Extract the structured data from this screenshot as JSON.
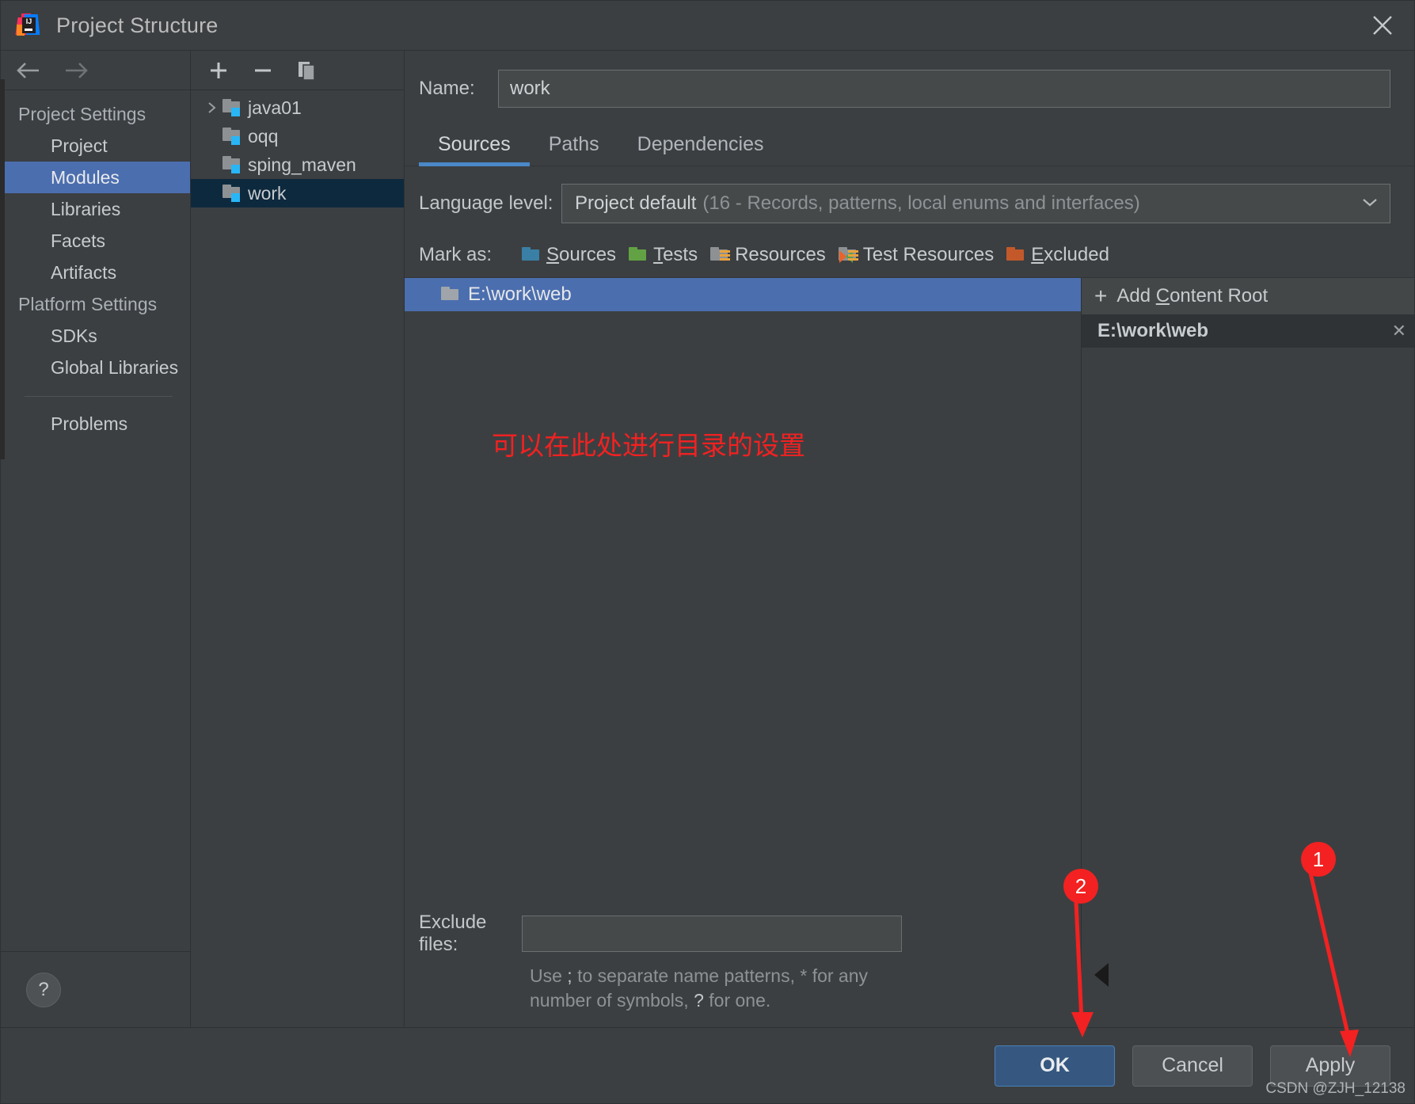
{
  "window": {
    "title": "Project Structure",
    "logo_text": "IJ",
    "close_icon": "close-icon"
  },
  "nav_toolbar": {
    "back_icon": "arrow-left-icon",
    "forward_icon": "arrow-right-icon"
  },
  "sidebar": {
    "groups": [
      {
        "label": "Project Settings",
        "items": [
          {
            "label": "Project",
            "selected": false
          },
          {
            "label": "Modules",
            "selected": true
          },
          {
            "label": "Libraries",
            "selected": false
          },
          {
            "label": "Facets",
            "selected": false
          },
          {
            "label": "Artifacts",
            "selected": false
          }
        ]
      },
      {
        "label": "Platform Settings",
        "items": [
          {
            "label": "SDKs",
            "selected": false
          },
          {
            "label": "Global Libraries",
            "selected": false
          }
        ]
      }
    ],
    "extra_item": {
      "label": "Problems"
    },
    "help_label": "?"
  },
  "tree_toolbar": {
    "add_icon": "plus-icon",
    "remove_icon": "minus-icon",
    "copy_icon": "copy-icon"
  },
  "module_tree": {
    "rows": [
      {
        "label": "java01",
        "expandable": true,
        "selected": false
      },
      {
        "label": "oqq",
        "expandable": false,
        "selected": false
      },
      {
        "label": "sping_maven",
        "expandable": false,
        "selected": false
      },
      {
        "label": "work",
        "expandable": false,
        "selected": true
      }
    ]
  },
  "detail": {
    "name_label": "Name:",
    "name_value": "work",
    "name_placeholder": "Module name",
    "tabs": [
      {
        "label": "Sources",
        "active": true
      },
      {
        "label": "Paths",
        "active": false
      },
      {
        "label": "Dependencies",
        "active": false
      }
    ],
    "language_level": {
      "label": "Language level:",
      "value": "Project default",
      "hint": "(16 - Records, patterns, local enums and interfaces)",
      "chevron_icon": "chevron-down-icon"
    },
    "mark_as": {
      "label": "Mark as:",
      "options": [
        {
          "label": "Sources",
          "mnemonic": "S",
          "rest": "ources",
          "color": "#3a7fa5",
          "kind": "plain"
        },
        {
          "label": "Tests",
          "mnemonic": "T",
          "rest": "ests",
          "color": "#62a244",
          "kind": "plain"
        },
        {
          "label": "Resources",
          "mnemonic": "",
          "rest": "Resources",
          "color": "#8e9193",
          "kind": "lines"
        },
        {
          "label": "Test Resources",
          "mnemonic": "",
          "rest": "Test Resources",
          "color": "#8e9193",
          "kind": "lines-tri"
        },
        {
          "label": "Excluded",
          "mnemonic": "E",
          "rest": "xcluded",
          "color": "#c3592a",
          "kind": "plain"
        }
      ]
    },
    "content_roots": [
      {
        "path": "E:\\work\\web",
        "selected": true
      }
    ],
    "annotation_note": "可以在此处进行目录的设置",
    "exclude": {
      "label": "Exclude files:",
      "value": "",
      "placeholder": "",
      "hint_line1_pre": "Use ",
      "hint_sep": ";",
      "hint_line1_post": " to separate name patterns, * for any",
      "hint_line2_pre": "number of symbols, ",
      "hint_q": "?",
      "hint_line2_post": " for one."
    },
    "right_panel": {
      "add_root_plus": "+",
      "add_root_pre": "Add ",
      "add_root_mnemonic": "C",
      "add_root_post": "ontent Root",
      "root_name": "E:\\work\\web",
      "root_close_icon": "close-icon"
    }
  },
  "footer": {
    "ok_label": "OK",
    "cancel_label": "Cancel",
    "apply_label": "Apply"
  },
  "annotations": {
    "marker_1": "1",
    "marker_2": "2",
    "arrow_color": "#f32121",
    "watermark": "CSDN @ZJH_12138"
  }
}
